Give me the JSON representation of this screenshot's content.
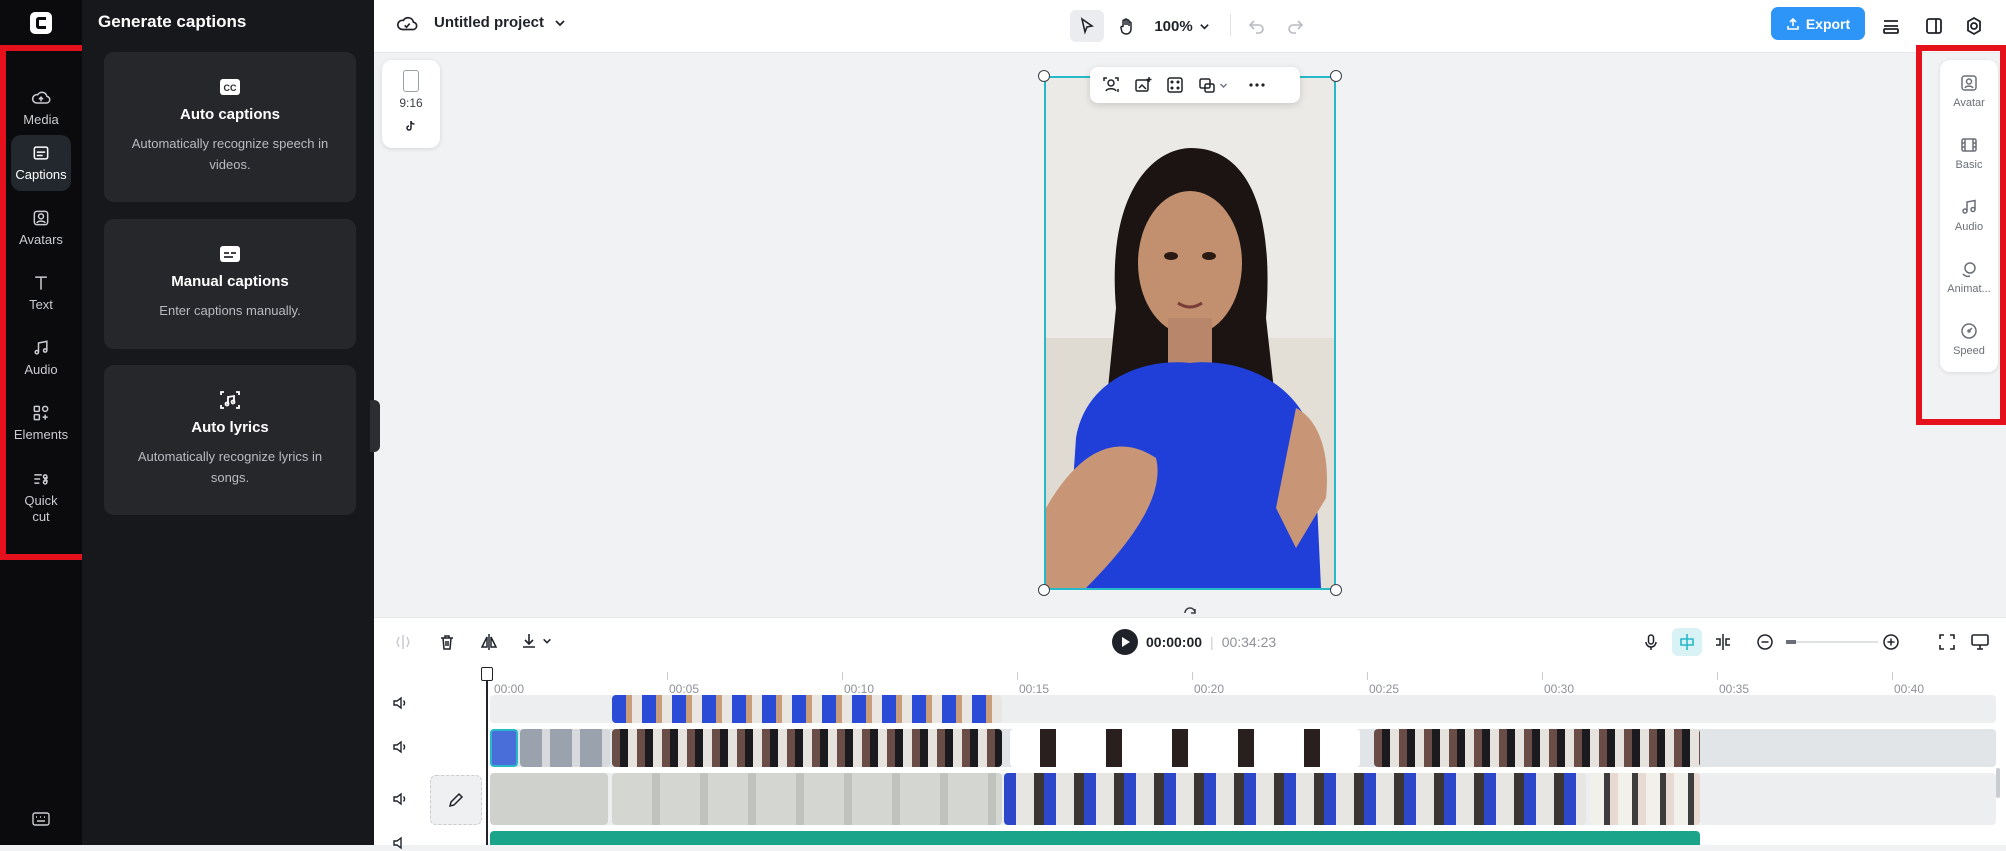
{
  "left_rail": {
    "items": [
      {
        "label": "Media",
        "icon": "cloud-upload-icon"
      },
      {
        "label": "Captions",
        "icon": "captions-icon",
        "active": true
      },
      {
        "label": "Avatars",
        "icon": "avatar-icon"
      },
      {
        "label": "Text",
        "icon": "text-icon"
      },
      {
        "label": "Audio",
        "icon": "music-note-icon"
      },
      {
        "label": "Elements",
        "icon": "elements-icon"
      },
      {
        "label": "Quick\ncut",
        "icon": "quick-cut-icon"
      }
    ]
  },
  "panel": {
    "title": "Generate captions",
    "cards": [
      {
        "title": "Auto captions",
        "desc": "Automatically recognize speech in videos.",
        "icon": "cc-icon"
      },
      {
        "title": "Manual captions",
        "desc": "Enter captions manually.",
        "icon": "subtitle-icon"
      },
      {
        "title": "Auto lyrics",
        "desc": "Automatically recognize lyrics in songs.",
        "icon": "lyrics-icon"
      }
    ]
  },
  "topbar": {
    "project_name": "Untitled project",
    "zoom": "100%",
    "export_label": "Export",
    "accent": "#2d94f8"
  },
  "canvas": {
    "aspect_ratio": "9:16",
    "platform_icon": "tiktok-icon",
    "selection_color": "#27b8c9"
  },
  "right_panel": {
    "items": [
      {
        "label": "Avatar",
        "icon": "avatar-add-icon"
      },
      {
        "label": "Basic",
        "icon": "film-icon"
      },
      {
        "label": "Audio",
        "icon": "music-note-icon"
      },
      {
        "label": "Animat...",
        "icon": "animation-icon"
      },
      {
        "label": "Speed",
        "icon": "speed-gauge-icon"
      }
    ]
  },
  "timeline": {
    "current_time": "00:00:00",
    "total_time": "00:34:23",
    "ruler": [
      "00:00",
      "00:05",
      "00:10",
      "00:15",
      "00:20",
      "00:25",
      "00:30",
      "00:35",
      "00:40"
    ]
  },
  "annotations": {
    "highlight_color": "#e4101c"
  }
}
